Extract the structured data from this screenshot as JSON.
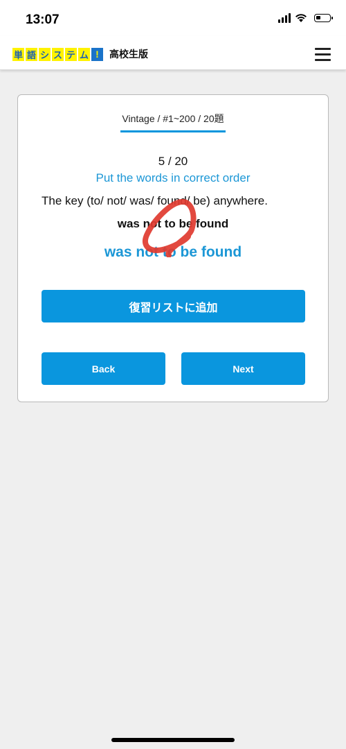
{
  "status_bar": {
    "time": "13:07",
    "icons": [
      "cellular-signal-icon",
      "wifi-icon",
      "battery-icon"
    ],
    "battery_level": 0.35
  },
  "app_header": {
    "logo_chars": [
      "単",
      "語",
      "シ",
      "ス",
      "テ",
      "ム"
    ],
    "logo_bang": "!",
    "edition": "高校生版",
    "menu_icon": "hamburger-menu-icon",
    "logo_colors": {
      "char_bg": "#fff200",
      "char_fg": "#1a5fb4",
      "bang_bg": "#1a73c9"
    }
  },
  "quiz": {
    "breadcrumb": "Vintage / #1~200 / 20題",
    "counter": "5 / 20",
    "instruction": "Put the words in correct order",
    "question": "The key (to/ not/ was/ found/ be) anywhere.",
    "user_answer": "was not to be found",
    "correct_answer": "was not to be found",
    "result_mark": "correct-circle-mark",
    "accent_color": "#1c97d6",
    "mark_color": "#e03a2f"
  },
  "buttons": {
    "review_label": "復習リストに追加",
    "back_label": "Back",
    "next_label": "Next",
    "button_color": "#0a96de"
  }
}
